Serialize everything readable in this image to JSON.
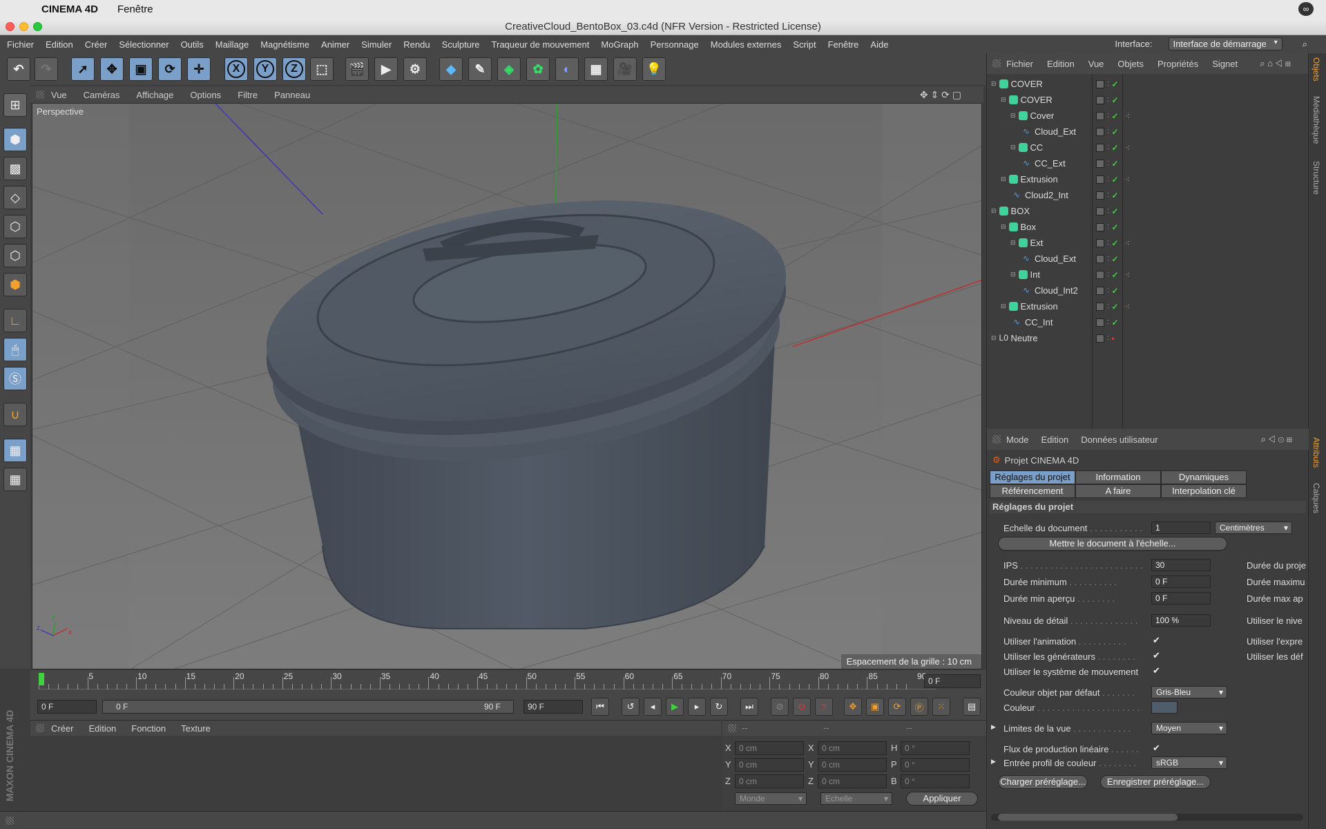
{
  "macbar": {
    "app": "CINEMA 4D",
    "menu": "Fenêtre"
  },
  "window": {
    "title": "CreativeCloud_BentoBox_03.c4d (NFR Version - Restricted License)"
  },
  "menu": {
    "items": [
      "Fichier",
      "Edition",
      "Créer",
      "Sélectionner",
      "Outils",
      "Maillage",
      "Magnétisme",
      "Animer",
      "Simuler",
      "Rendu",
      "Sculpture",
      "Traqueur de mouvement",
      "MoGraph",
      "Personnage",
      "Modules externes",
      "Script",
      "Fenêtre",
      "Aide"
    ],
    "interface_label": "Interface:",
    "interface_value": "Interface de démarrage"
  },
  "toolbar": {
    "x": "X",
    "y": "Y",
    "z": "Z"
  },
  "viewport": {
    "menu": [
      "Vue",
      "Caméras",
      "Affichage",
      "Options",
      "Filtre",
      "Panneau"
    ],
    "label": "Perspective",
    "grid_spacing": "Espacement de la grille : 10 cm"
  },
  "timeline": {
    "ticks": [
      "0",
      "5",
      "10",
      "15",
      "20",
      "25",
      "30",
      "35",
      "40",
      "45",
      "50",
      "55",
      "60",
      "65",
      "70",
      "75",
      "80",
      "85",
      "90"
    ],
    "current": "0 F",
    "start": "0 F",
    "slider_start": "0 F",
    "slider_end": "90 F",
    "end": "90 F"
  },
  "materials": {
    "menu": [
      "Créer",
      "Edition",
      "Fonction",
      "Texture"
    ]
  },
  "coords": {
    "headers": [
      "--",
      "--",
      "--"
    ],
    "rows": [
      {
        "a": "X",
        "av": "0 cm",
        "b": "X",
        "bv": "0 cm",
        "c": "H",
        "cv": "0 °"
      },
      {
        "a": "Y",
        "av": "0 cm",
        "b": "Y",
        "bv": "0 cm",
        "c": "P",
        "cv": "0 °"
      },
      {
        "a": "Z",
        "av": "0 cm",
        "b": "Z",
        "bv": "0 cm",
        "c": "B",
        "cv": "0 °"
      }
    ],
    "mode1": "Monde",
    "mode2": "Echelle",
    "apply": "Appliquer"
  },
  "objects": {
    "menu": [
      "Fichier",
      "Edition",
      "Vue",
      "Objets",
      "Propriétés",
      "Signet"
    ],
    "tree": [
      {
        "name": "COVER",
        "depth": 0,
        "tag": false
      },
      {
        "name": "COVER",
        "depth": 1,
        "tag": false
      },
      {
        "name": "Cover",
        "depth": 2,
        "tag": true
      },
      {
        "name": "Cloud_Ext",
        "depth": 3,
        "tag": false
      },
      {
        "name": "CC",
        "depth": 2,
        "tag": true
      },
      {
        "name": "CC_Ext",
        "depth": 3,
        "tag": false
      },
      {
        "name": "Extrusion",
        "depth": 1,
        "tag": true
      },
      {
        "name": "Cloud2_Int",
        "depth": 2,
        "tag": false
      },
      {
        "name": "BOX",
        "depth": 0,
        "tag": false
      },
      {
        "name": "Box",
        "depth": 1,
        "tag": false
      },
      {
        "name": "Ext",
        "depth": 2,
        "tag": true
      },
      {
        "name": "Cloud_Ext",
        "depth": 3,
        "tag": false
      },
      {
        "name": "Int",
        "depth": 2,
        "tag": true
      },
      {
        "name": "Cloud_Int2",
        "depth": 3,
        "tag": false
      },
      {
        "name": "Extrusion",
        "depth": 1,
        "tag": true
      },
      {
        "name": "CC_Int",
        "depth": 2,
        "tag": false
      },
      {
        "name": "Neutre",
        "depth": 0,
        "tag": false
      }
    ]
  },
  "side_tabs": [
    "Objets",
    "Médiathèque",
    "Structure",
    "Attributs",
    "Calques"
  ],
  "attributes": {
    "menu": [
      "Mode",
      "Edition",
      "Données utilisateur"
    ],
    "object": "Projet CINEMA 4D",
    "tabs_row1": [
      "Réglages du projet",
      "Information",
      "Dynamiques"
    ],
    "tabs_row2": [
      "Référencement",
      "A faire",
      "Interpolation clé"
    ],
    "section": "Réglages du projet",
    "doc_scale_label": "Echelle du document",
    "doc_scale_value": "1",
    "doc_scale_unit": "Centimètres",
    "scale_button": "Mettre le document à l'échelle...",
    "fps_label": "IPS",
    "fps_value": "30",
    "min_time_label": "Durée minimum",
    "min_time_value": "0 F",
    "min_preview_label": "Durée min aperçu",
    "min_preview_value": "0 F",
    "lod_label": "Niveau de détail",
    "lod_value": "100 %",
    "right_col": [
      "Durée du proje",
      "Durée maximu",
      "Durée max ap",
      "Utiliser le nive",
      "Utiliser l'expre",
      "Utiliser les déf"
    ],
    "use_anim": "Utiliser l'animation",
    "use_gen": "Utiliser les générateurs",
    "use_motion": "Utiliser le système de mouvement",
    "obj_color_label": "Couleur objet par défaut",
    "obj_color_value": "Gris-Bleu",
    "color_label": "Couleur",
    "view_clip_label": "Limites de la vue",
    "view_clip_value": "Moyen",
    "linear_label": "Flux de production linéaire",
    "color_profile_label": "Entrée profil de couleur",
    "color_profile_value": "sRGB",
    "load_preset": "Charger préréglage...",
    "save_preset": "Enregistrer préréglage...",
    "check": "✔"
  }
}
